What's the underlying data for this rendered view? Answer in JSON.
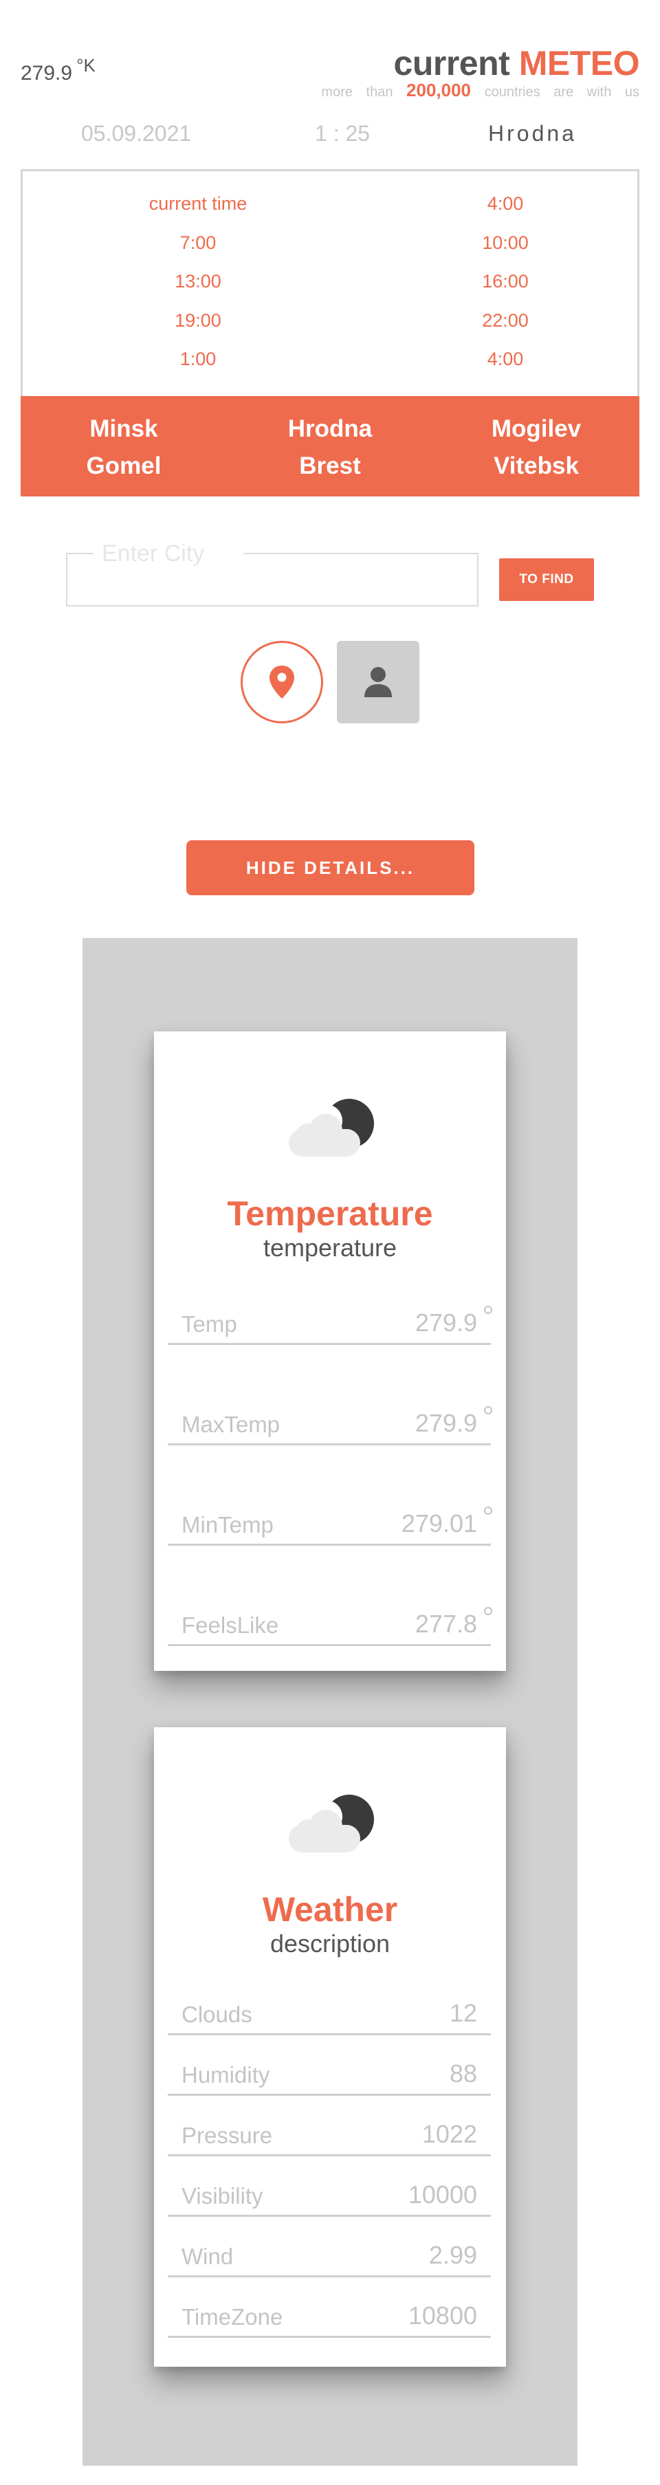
{
  "header": {
    "temp_value": "279.9",
    "temp_unit": "°K",
    "brand_word1": "current",
    "brand_word2": "METEO",
    "sub_prefix": "more than",
    "sub_number": "200,000",
    "sub_suffix": "countries are with us"
  },
  "info": {
    "date": "05.09.2021",
    "time": "1 : 25",
    "city": "Hrodna"
  },
  "times": [
    "current time",
    "4:00",
    "7:00",
    "10:00",
    "13:00",
    "16:00",
    "19:00",
    "22:00",
    "1:00",
    "4:00"
  ],
  "cities": [
    "Minsk",
    "Hrodna",
    "Mogilev",
    "Gomel",
    "Brest",
    "Vitebsk"
  ],
  "search": {
    "legend": "Enter City",
    "value": "",
    "find_label": "TO FIND"
  },
  "details": {
    "hide_label": "HIDE DETAILS..."
  },
  "temperature_card": {
    "title": "Temperature",
    "subtitle": "temperature",
    "rows": [
      {
        "label": "Temp",
        "value": "279.9"
      },
      {
        "label": "MaxTemp",
        "value": "279.9"
      },
      {
        "label": "MinTemp",
        "value": "279.01"
      },
      {
        "label": "FeelsLike",
        "value": "277.8"
      }
    ]
  },
  "weather_card": {
    "title": "Weather",
    "subtitle": "description",
    "rows": [
      {
        "label": "Clouds",
        "value": "12"
      },
      {
        "label": "Humidity",
        "value": "88"
      },
      {
        "label": "Pressure",
        "value": "1022"
      },
      {
        "label": "Visibility",
        "value": "10000"
      },
      {
        "label": "Wind",
        "value": "2.99"
      },
      {
        "label": "TimeZone",
        "value": "10800"
      }
    ]
  },
  "colors": {
    "accent": "#ee6b4d",
    "panel": "#d1d1d1",
    "muted_text": "#c4c4c4"
  },
  "icons": [
    "map-pin-icon",
    "user-icon",
    "cloud-moon-icon"
  ]
}
